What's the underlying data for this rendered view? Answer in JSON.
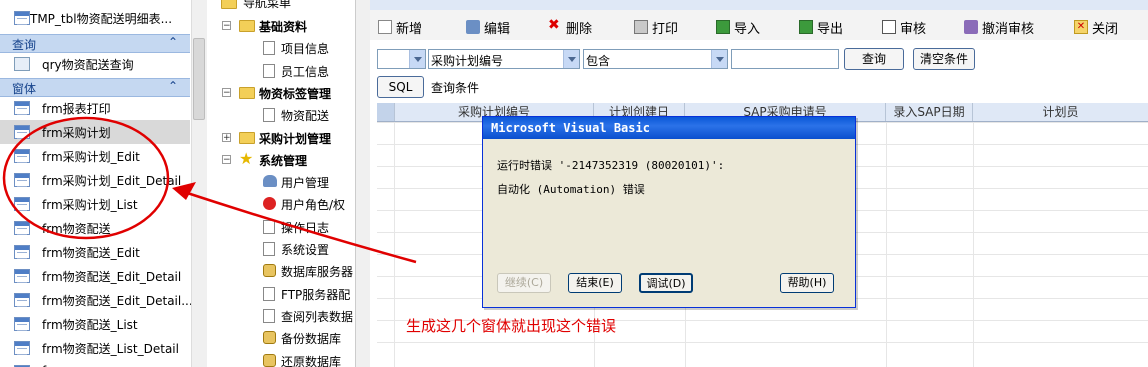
{
  "nav": {
    "top_item": "TMP_tbl物资配送明细表...",
    "groups": [
      {
        "label": "查询"
      },
      {
        "label": "窗体"
      }
    ],
    "query_item": "qry物资配送查询",
    "forms": [
      "frm报表打印",
      "frm采购计划",
      "frm采购计划_Edit",
      "frm采购计划_Edit_Detail",
      "frm采购计划_List",
      "frm物资配送",
      "frm物资配送_Edit",
      "frm物资配送_Edit_Detail",
      "frm物资配送_Edit_Detail...",
      "frm物资配送_List",
      "frm物资配送_List_Detail"
    ],
    "cut_item": "frm..."
  },
  "tree": {
    "header": "导航菜单",
    "items": [
      {
        "label": "基础资料",
        "kind": "folder",
        "level": 1
      },
      {
        "label": "项目信息",
        "kind": "doc",
        "level": 2
      },
      {
        "label": "员工信息",
        "kind": "doc",
        "level": 2
      },
      {
        "label": "物资标签管理",
        "kind": "folder",
        "level": 1
      },
      {
        "label": "物资配送",
        "kind": "doc",
        "level": 2
      },
      {
        "label": "采购计划管理",
        "kind": "folder",
        "level": 1
      },
      {
        "label": "系统管理",
        "kind": "star",
        "level": 1
      },
      {
        "label": "用户管理",
        "kind": "users",
        "level": 2
      },
      {
        "label": "用户角色/权",
        "kind": "stop",
        "level": 2
      },
      {
        "label": "操作日志",
        "kind": "doc",
        "level": 2
      },
      {
        "label": "系统设置",
        "kind": "doc",
        "level": 2
      },
      {
        "label": "数据库服务器",
        "kind": "db",
        "level": 2
      },
      {
        "label": "FTP服务器配",
        "kind": "doc",
        "level": 2
      },
      {
        "label": "查阅列表数据",
        "kind": "doc",
        "level": 2
      },
      {
        "label": "备份数据库",
        "kind": "db",
        "level": 2
      },
      {
        "label": "还原数据库",
        "kind": "db",
        "level": 2
      }
    ]
  },
  "toolbar": {
    "add": "新增",
    "edit": "编辑",
    "delete": "删除",
    "print": "打印",
    "import": "导入",
    "export": "导出",
    "audit": "审核",
    "unaudit": "撤消审核",
    "close": "关闭"
  },
  "filter": {
    "logic_value": "",
    "field_value": "采购计划编号",
    "operator_value": "包含",
    "input_value": "",
    "query_button": "查询",
    "clear_button": "清空条件",
    "sql_button": "SQL",
    "condition_label": "查询条件"
  },
  "grid": {
    "columns": [
      "采购计划编号",
      "计划创建日",
      "SAP采购申请号",
      "录入SAP日期",
      "计划员"
    ]
  },
  "dialog": {
    "title": "Microsoft Visual Basic",
    "message_line1": "运行时错误 '-2147352319 (80020101)':",
    "message_line2": "自动化 (Automation) 错误",
    "buttons": {
      "continue": "继续(C)",
      "end": "结束(E)",
      "debug": "调试(D)",
      "help": "帮助(H)"
    }
  },
  "annotation": {
    "note": "生成这几个窗体就出现这个错误",
    "color": "#e00000"
  }
}
